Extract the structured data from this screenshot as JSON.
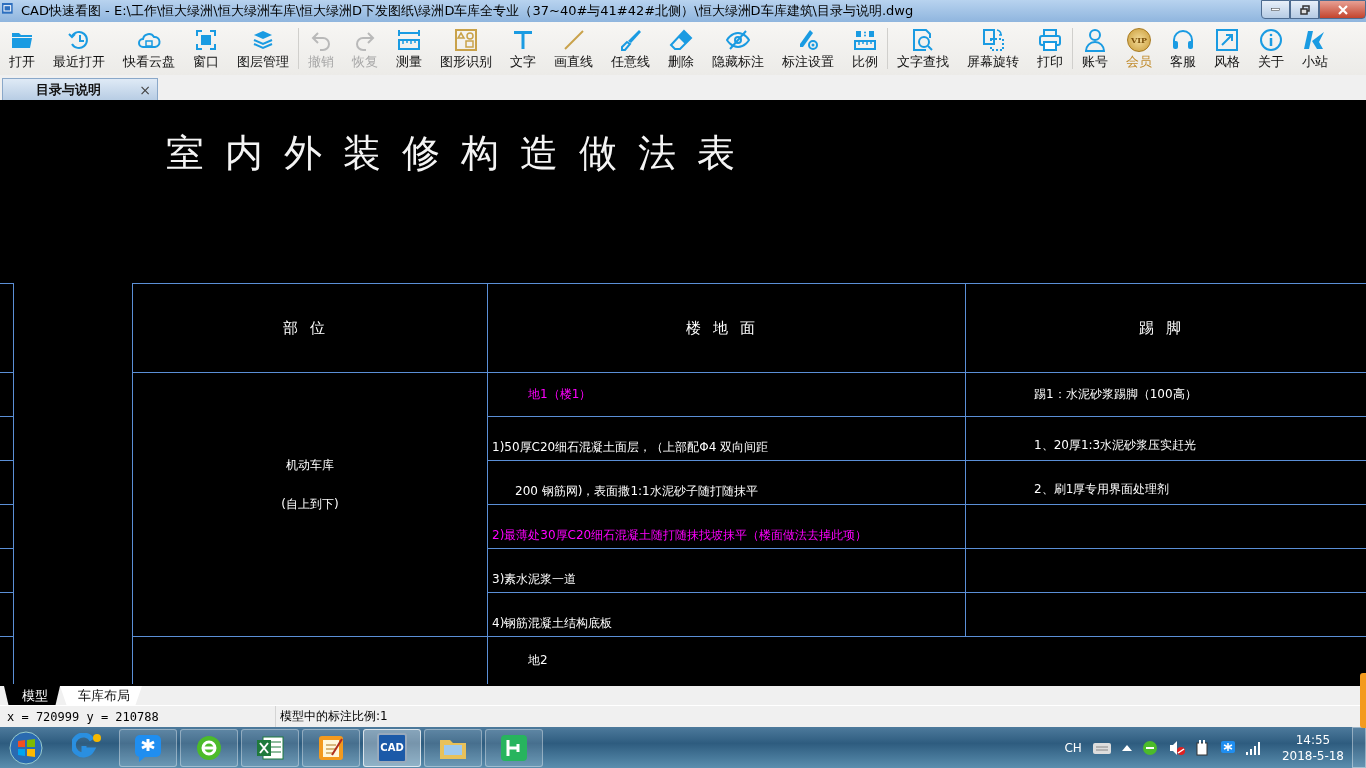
{
  "window": {
    "title": "CAD快速看图 - E:\\工作\\恒大绿洲\\恒大绿洲车库\\恒大绿洲D下发图纸\\绿洲D车库全专业（37~40#与41#42#北侧）\\恒大绿洲D车库建筑\\目录与说明.dwg"
  },
  "toolbar": {
    "groups": [
      [
        {
          "label": "打开",
          "disabled": false,
          "accent": false
        },
        {
          "label": "最近打开",
          "disabled": false,
          "accent": false
        },
        {
          "label": "快看云盘",
          "disabled": false,
          "accent": false
        },
        {
          "label": "窗口",
          "disabled": false,
          "accent": false
        },
        {
          "label": "图层管理",
          "disabled": false,
          "accent": false
        }
      ],
      [
        {
          "label": "撤销",
          "disabled": true,
          "accent": false
        },
        {
          "label": "恢复",
          "disabled": true,
          "accent": false
        },
        {
          "label": "测量",
          "disabled": false,
          "accent": false
        },
        {
          "label": "图形识别",
          "disabled": false,
          "accent": false
        },
        {
          "label": "文字",
          "disabled": false,
          "accent": false
        },
        {
          "label": "画直线",
          "disabled": false,
          "accent": false
        },
        {
          "label": "任意线",
          "disabled": false,
          "accent": false
        },
        {
          "label": "删除",
          "disabled": false,
          "accent": false
        },
        {
          "label": "隐藏标注",
          "disabled": false,
          "accent": false
        },
        {
          "label": "标注设置",
          "disabled": false,
          "accent": false
        },
        {
          "label": "比例",
          "disabled": false,
          "accent": false
        }
      ],
      [
        {
          "label": "文字查找",
          "disabled": false,
          "accent": false
        },
        {
          "label": "屏幕旋转",
          "disabled": false,
          "accent": false
        },
        {
          "label": "打印",
          "disabled": false,
          "accent": false
        }
      ],
      [
        {
          "label": "账号",
          "disabled": false,
          "accent": false
        },
        {
          "label": "会员",
          "disabled": false,
          "accent": true,
          "badge": "VIP"
        },
        {
          "label": "客服",
          "disabled": false,
          "accent": false
        },
        {
          "label": "风格",
          "disabled": false,
          "accent": false
        },
        {
          "label": "关于",
          "disabled": false,
          "accent": false
        },
        {
          "label": "小站",
          "disabled": false,
          "accent": false
        }
      ]
    ]
  },
  "document_tabs": [
    {
      "label": "目录与说明",
      "selected": true,
      "close": "×"
    }
  ],
  "drawing": {
    "title": "室内外装修构造做法表",
    "table": {
      "columns": [
        "部位",
        "楼地面",
        "踢脚"
      ],
      "location": [
        "机动车库",
        "(自上到下)"
      ],
      "floor": [
        {
          "text": "地1（楼1）",
          "kind": "title",
          "color": "#ff00ff"
        },
        {
          "text": "1)50厚C20细石混凝土面层，（上部配Φ4 双向间距",
          "kind": "line",
          "color": "#ffffff"
        },
        {
          "text": "200 钢筋网)，表面撒1:1水泥砂子随打随抹平",
          "kind": "continued",
          "color": "#ffffff"
        },
        {
          "text": "2)最薄处30厚C20细石混凝土随打随抹找坡抹平（楼面做法去掉此项）",
          "kind": "line",
          "color": "#ff00ff"
        },
        {
          "text": "3)素水泥浆一道",
          "kind": "line",
          "color": "#ffffff"
        },
        {
          "text": "4)钢筋混凝土结构底板",
          "kind": "line",
          "color": "#ffffff"
        }
      ],
      "skirting": [
        "踢1：水泥砂浆踢脚（100高）",
        "1、20厚1:3水泥砂浆压实赶光",
        "2、刷1厚专用界面处理剂"
      ],
      "next_floor": "地2"
    }
  },
  "layout_tabs": [
    {
      "label": "模型",
      "selected": true
    },
    {
      "label": "车库布局",
      "selected": false
    }
  ],
  "status_bar": {
    "coordinates": "x = 720999 y = 210788",
    "scale": "模型中的标注比例:1"
  },
  "taskbar": {
    "apps": [
      {
        "active": false
      },
      {
        "active": false
      },
      {
        "active": false
      },
      {
        "active": false
      },
      {
        "active": false
      },
      {
        "active": true,
        "icon_text": "CAD"
      },
      {
        "active": false
      },
      {
        "active": false
      }
    ],
    "language": "CH",
    "time": "14:55",
    "date": "2018-5-18"
  }
}
